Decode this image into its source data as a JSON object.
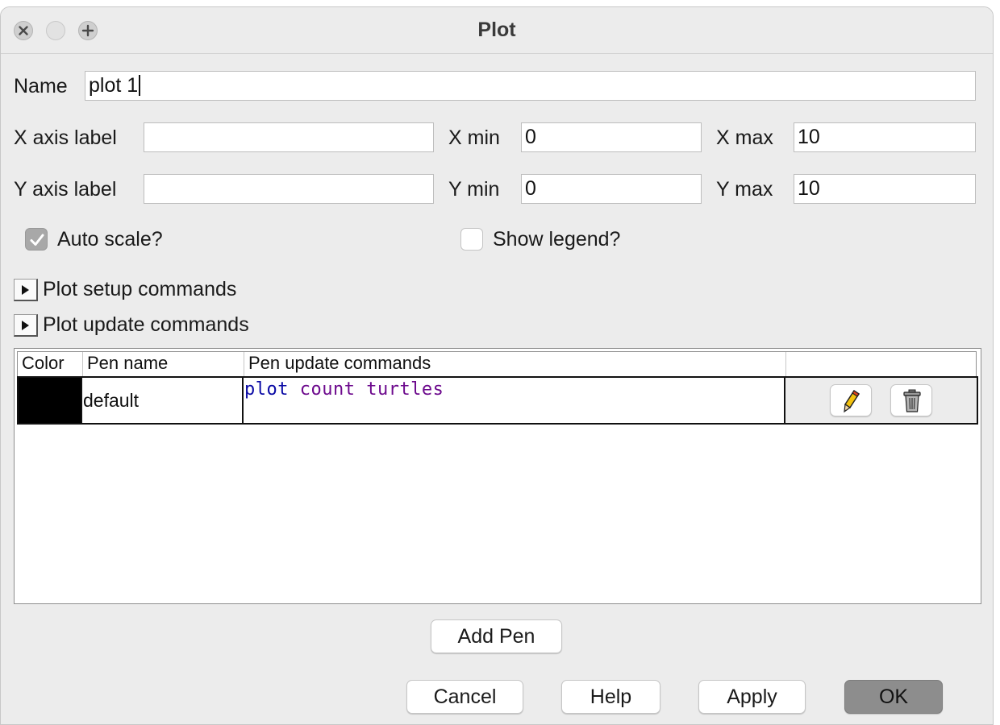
{
  "window": {
    "title": "Plot"
  },
  "form": {
    "name_label": "Name",
    "name_value": "plot 1",
    "x_axis_label": "X axis label",
    "x_axis_value": "",
    "x_min_label": "X min",
    "x_min_value": "0",
    "x_max_label": "X max",
    "x_max_value": "10",
    "y_axis_label": "Y axis label",
    "y_axis_value": "",
    "y_min_label": "Y min",
    "y_min_value": "0",
    "y_max_label": "Y max",
    "y_max_value": "10",
    "auto_scale_label": "Auto scale?",
    "auto_scale_checked": true,
    "show_legend_label": "Show legend?",
    "show_legend_checked": false
  },
  "sections": {
    "setup_label": "Plot setup commands",
    "update_label": "Plot update commands"
  },
  "pens": {
    "columns": [
      "Color",
      "Pen name",
      "Pen update commands",
      ""
    ],
    "rows": [
      {
        "color": "#000000",
        "name": "default",
        "code_keyword": "plot",
        "code_rest": "count turtles",
        "edit_icon": "pencil-icon",
        "delete_icon": "trash-icon"
      }
    ]
  },
  "buttons": {
    "add_pen": "Add Pen",
    "cancel": "Cancel",
    "help": "Help",
    "apply": "Apply",
    "ok": "OK"
  },
  "colors": {
    "code_keyword": "#0a0aa5",
    "code_reporter": "#6d0a8d"
  }
}
